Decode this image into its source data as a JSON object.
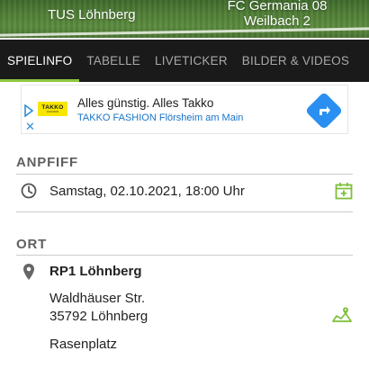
{
  "header": {
    "home_team": "TUS Löhnberg",
    "away_team_line1": "FC Germania 08",
    "away_team_line2": "Weilbach 2"
  },
  "tabs": [
    {
      "label": "SPIELINFO",
      "active": true
    },
    {
      "label": "TABELLE",
      "active": false
    },
    {
      "label": "LIVETICKER",
      "active": false
    },
    {
      "label": "BILDER & VIDEOS",
      "active": false
    }
  ],
  "ad": {
    "logo_text": "TAKKO",
    "logo_sub": "FASHION",
    "title": "Alles günstig. Alles Takko",
    "subtitle": "TAKKO FASHION Flörsheim am Main",
    "close_glyph": "✕"
  },
  "kickoff": {
    "heading": "ANPFIFF",
    "datetime": "Samstag, 02.10.2021, 18:00 Uhr"
  },
  "venue": {
    "heading": "ORT",
    "name": "RP1 Löhnberg",
    "street": "Waldhäuser Str.",
    "city": "35792 Löhnberg",
    "surface": "Rasenplatz"
  },
  "colors": {
    "accent_green": "#8dc63f",
    "tab_bar": "#1a1a1a",
    "ad_blue": "#2a8ff0"
  }
}
